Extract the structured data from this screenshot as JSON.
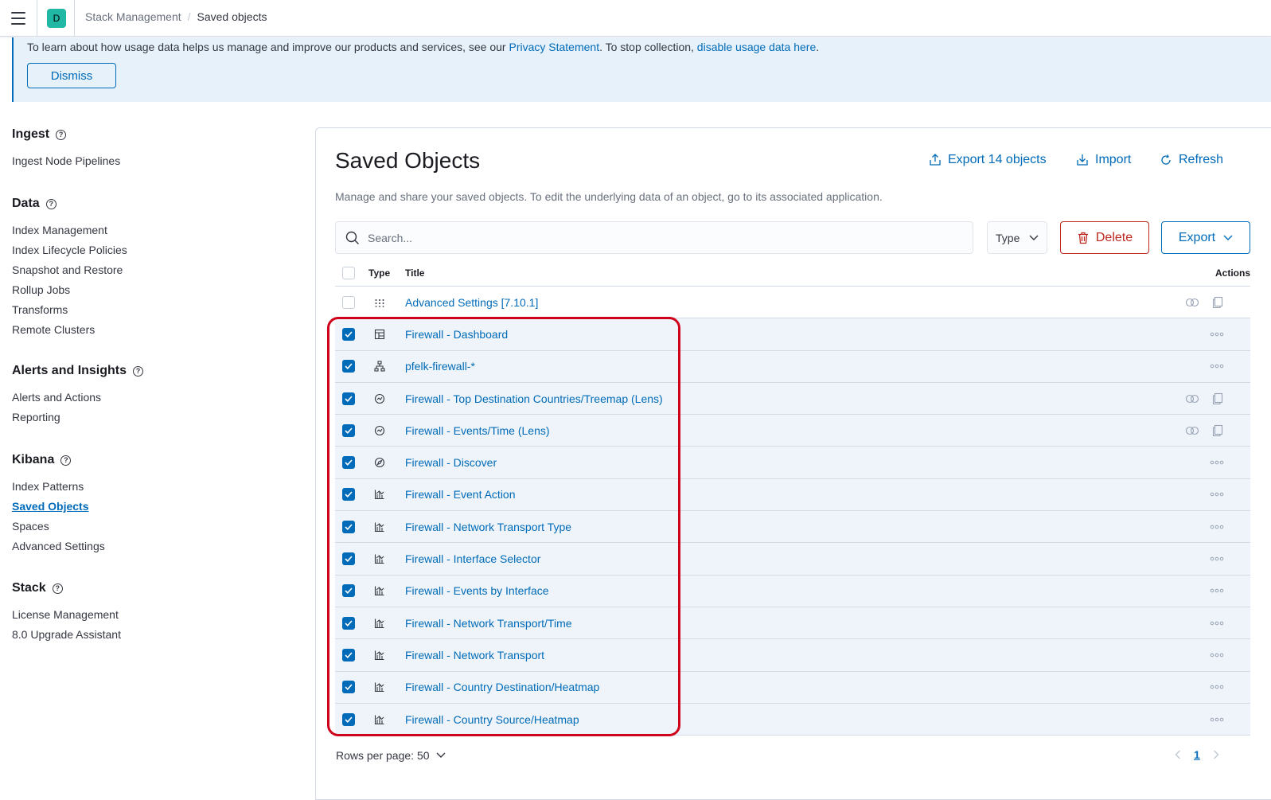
{
  "header": {
    "space_initial": "D",
    "breadcrumbs": [
      "Stack Management",
      "Saved objects"
    ],
    "crumb_separator": "/"
  },
  "banner": {
    "text_before": "To learn about how usage data helps us manage and improve our products and services, see our ",
    "privacy_link": "Privacy Statement",
    "text_middle": ". To stop collection, ",
    "disable_link": "disable usage data here",
    "text_after": ".",
    "dismiss_label": "Dismiss"
  },
  "sidebar": {
    "groups": [
      {
        "heading": "Ingest",
        "items": [
          "Ingest Node Pipelines"
        ]
      },
      {
        "heading": "Data",
        "items": [
          "Index Management",
          "Index Lifecycle Policies",
          "Snapshot and Restore",
          "Rollup Jobs",
          "Transforms",
          "Remote Clusters"
        ]
      },
      {
        "heading": "Alerts and Insights",
        "items": [
          "Alerts and Actions",
          "Reporting"
        ]
      },
      {
        "heading": "Kibana",
        "items": [
          "Index Patterns",
          "Saved Objects",
          "Spaces",
          "Advanced Settings"
        ]
      },
      {
        "heading": "Stack",
        "items": [
          "License Management",
          "8.0 Upgrade Assistant"
        ]
      }
    ],
    "active_item": "Saved Objects",
    "help_glyph": "?"
  },
  "main": {
    "title": "Saved Objects",
    "subtitle": "Manage and share your saved objects. To edit the underlying data of an object, go to its associated application.",
    "export_all_label": "Export 14 objects",
    "import_label": "Import",
    "refresh_label": "Refresh",
    "search_placeholder": "Search...",
    "type_filter_label": "Type",
    "delete_label": "Delete",
    "export_label": "Export"
  },
  "table": {
    "columns": {
      "type": "Type",
      "title": "Title",
      "actions": "Actions"
    },
    "rows": [
      {
        "title": "Advanced Settings [7.10.1]",
        "type_icon": "config-icon",
        "checked": false,
        "actions": "relationships"
      },
      {
        "title": "Firewall - Dashboard",
        "type_icon": "dashboard-icon",
        "checked": true,
        "actions": "more"
      },
      {
        "title": "pfelk-firewall-*",
        "type_icon": "index-pattern-icon",
        "checked": true,
        "actions": "more"
      },
      {
        "title": "Firewall - Top Destination Countries/Treemap (Lens)",
        "type_icon": "lens-icon",
        "checked": true,
        "actions": "relationships"
      },
      {
        "title": "Firewall - Events/Time (Lens)",
        "type_icon": "lens-icon",
        "checked": true,
        "actions": "relationships"
      },
      {
        "title": "Firewall - Discover",
        "type_icon": "discover-icon",
        "checked": true,
        "actions": "more"
      },
      {
        "title": "Firewall - Event Action",
        "type_icon": "visualization-icon",
        "checked": true,
        "actions": "more"
      },
      {
        "title": "Firewall - Network Transport Type",
        "type_icon": "visualization-icon",
        "checked": true,
        "actions": "more"
      },
      {
        "title": "Firewall - Interface Selector",
        "type_icon": "visualization-icon",
        "checked": true,
        "actions": "more"
      },
      {
        "title": "Firewall - Events by Interface",
        "type_icon": "visualization-icon",
        "checked": true,
        "actions": "more"
      },
      {
        "title": "Firewall - Network Transport/Time",
        "type_icon": "visualization-icon",
        "checked": true,
        "actions": "more"
      },
      {
        "title": "Firewall - Network Transport",
        "type_icon": "visualization-icon",
        "checked": true,
        "actions": "more"
      },
      {
        "title": "Firewall - Country Destination/Heatmap",
        "type_icon": "visualization-icon",
        "checked": true,
        "actions": "more"
      },
      {
        "title": "Firewall - Country Source/Heatmap",
        "type_icon": "visualization-icon",
        "checked": true,
        "actions": "more"
      }
    ]
  },
  "footer": {
    "rows_per_page_label": "Rows per page: 50",
    "current_page": "1"
  },
  "colors": {
    "link": "#006bb8",
    "danger": "#bd271e",
    "highlight_annotation": "#d0021b",
    "selected_row_bg": "#eef4f9",
    "banner_bg": "#e6f1fa",
    "space_avatar": "#20b8a5"
  }
}
